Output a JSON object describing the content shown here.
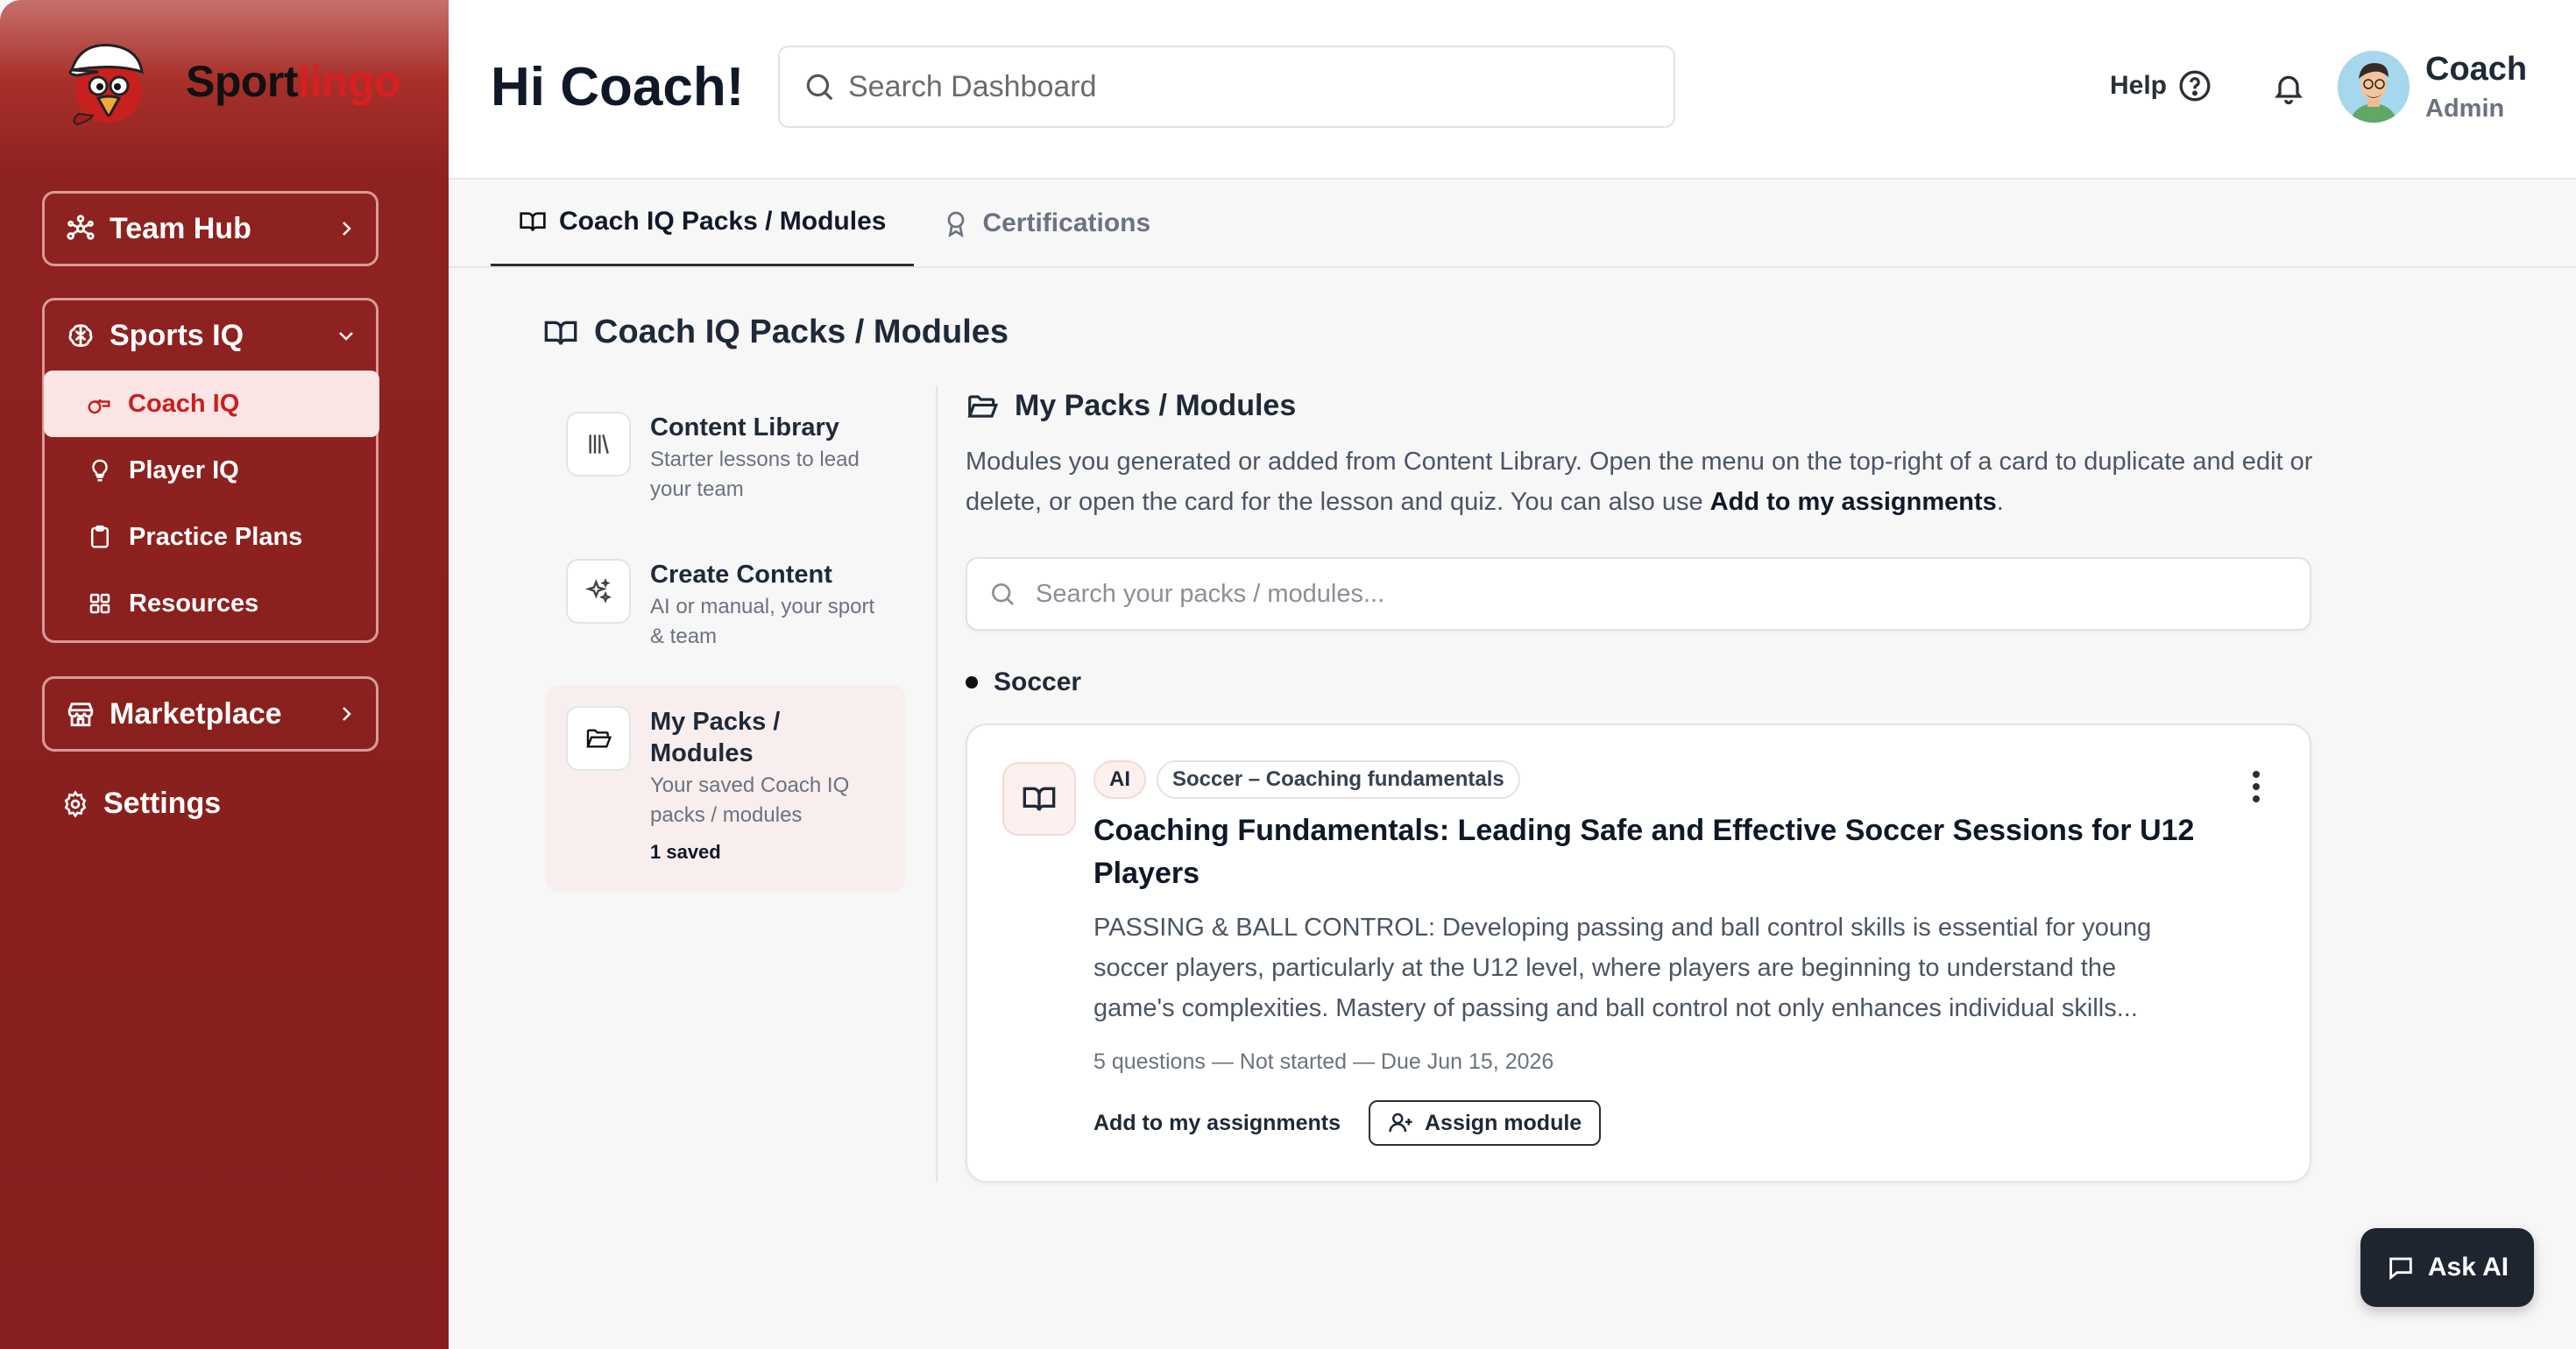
{
  "brand": {
    "name_part1": "Sport",
    "name_part2": "lingo"
  },
  "sidebar": {
    "team_hub": "Team Hub",
    "sports_iq": "Sports IQ",
    "sub_items": [
      "Coach IQ",
      "Player IQ",
      "Practice Plans",
      "Resources"
    ],
    "marketplace": "Marketplace",
    "settings": "Settings"
  },
  "header": {
    "greeting": "Hi Coach!",
    "search_placeholder": "Search Dashboard",
    "help": "Help",
    "user_name": "Coach",
    "user_role": "Admin"
  },
  "tabs": [
    "Coach IQ Packs / Modules",
    "Certifications"
  ],
  "section_title": "Coach IQ Packs / Modules",
  "side_nav": [
    {
      "title": "Content Library",
      "desc": "Starter lessons to lead your team"
    },
    {
      "title": "Create Content",
      "desc": "AI or manual, your sport & team"
    },
    {
      "title": "My Packs / Modules",
      "desc": "Your saved Coach IQ packs / modules",
      "count": "1 saved"
    }
  ],
  "my_packs": {
    "title": "My Packs / Modules",
    "desc_part1": "Modules you generated or added from Content Library. Open the menu on the top-right of a card to duplicate and edit or delete, or open the card for the lesson and quiz. You can also use ",
    "desc_bold": "Add to my assignments",
    "desc_part2": ".",
    "search_placeholder": "Search your packs / modules...",
    "group": "Soccer"
  },
  "card": {
    "badge_ai": "AI",
    "badge_topic": "Soccer – Coaching fundamentals",
    "title": "Coaching Fundamentals: Leading Safe and Effective Soccer Sessions for U12 Players",
    "body": "PASSING & BALL CONTROL: Developing passing and ball control skills is essential for young soccer players, particularly at the U12 level, where players are beginning to understand the game's complexities. Mastery of passing and ball control not only enhances individual skills...",
    "meta": "5 questions — Not started — Due Jun 15, 2026",
    "add_link": "Add to my assignments",
    "assign_button": "Assign module"
  },
  "ask_ai": "Ask AI",
  "colors": {
    "sidebar": "#8e2220",
    "brand_red": "#d81f22",
    "active_bg": "#fbe5e4"
  }
}
